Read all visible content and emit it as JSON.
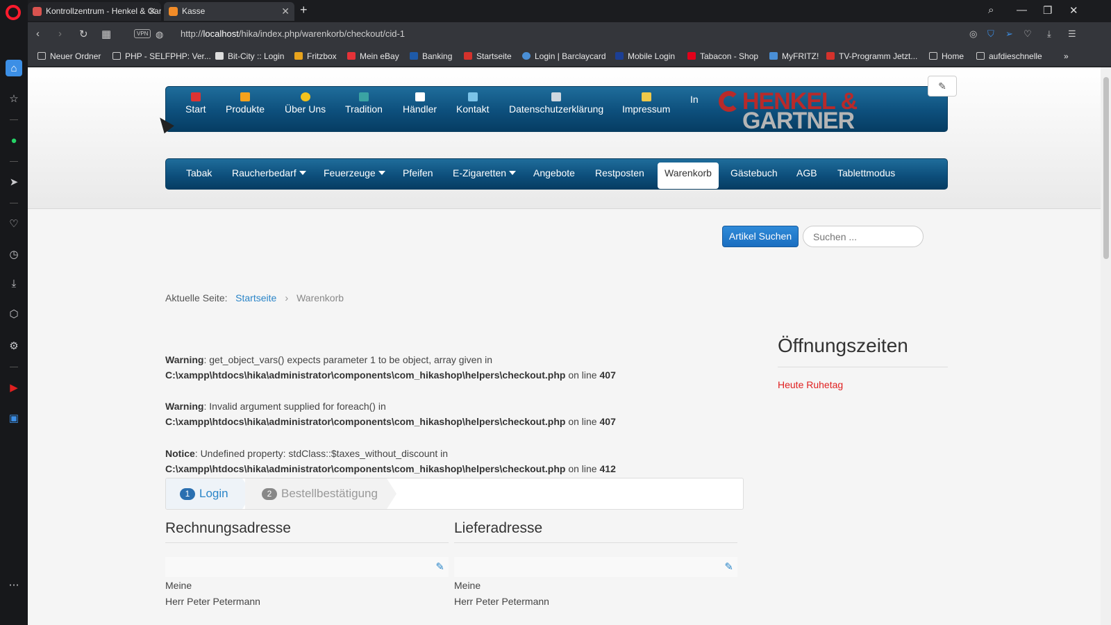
{
  "browser": {
    "tabs": [
      {
        "title": "Kontrollzentrum - Henkel & Gartner"
      },
      {
        "title": "Kasse"
      }
    ],
    "url_prefix": "http://",
    "url_host": "localhost",
    "url_path": "/hika/index.php/warenkorb/checkout/cid-1",
    "vpn_label": "VPN",
    "bookmarks": [
      "Neuer Ordner",
      "PHP - SELFPHP: Ver...",
      "Bit-City :: Login",
      "Fritzbox",
      "Mein eBay",
      "Banking",
      "Startseite",
      "Login | Barclaycard",
      "Mobile Login",
      "Tabacon - Shop",
      "MyFRITZ!",
      "TV-Programm Jetzt...",
      "Home",
      "aufdieschnelle"
    ]
  },
  "topnav": {
    "items": [
      "Start",
      "Produkte",
      "Über Uns",
      "Tradition",
      "Händler",
      "Kontakt",
      "Datenschutzerklärung",
      "Impressum",
      "In"
    ],
    "logo_line1": "HENKEL &",
    "logo_line2": "GARTNER"
  },
  "mainnav": {
    "items": [
      {
        "label": "Tabak",
        "dropdown": false
      },
      {
        "label": "Raucherbedarf",
        "dropdown": true
      },
      {
        "label": "Feuerzeuge",
        "dropdown": true
      },
      {
        "label": "Pfeifen",
        "dropdown": false
      },
      {
        "label": "E-Zigaretten",
        "dropdown": true
      },
      {
        "label": "Angebote",
        "dropdown": false
      },
      {
        "label": "Restposten",
        "dropdown": false
      },
      {
        "label": "Warenkorb",
        "dropdown": false,
        "active": true
      },
      {
        "label": "Gästebuch",
        "dropdown": false
      },
      {
        "label": "AGB",
        "dropdown": false
      },
      {
        "label": "Tablettmodus",
        "dropdown": false
      }
    ]
  },
  "search": {
    "button_label": "Artikel Suchen",
    "placeholder": "Suchen ..."
  },
  "breadcrumb": {
    "prefix": "Aktuelle Seite:",
    "home": "Startseite",
    "current": "Warenkorb"
  },
  "messages": [
    {
      "type": "Warning",
      "text": ": get_object_vars() expects parameter 1 to be object, array given in",
      "path": "C:\\xampp\\htdocs\\hika\\administrator\\components\\com_hikashop\\helpers\\checkout.php",
      "on_line": " on line ",
      "line": "407"
    },
    {
      "type": "Warning",
      "text": ": Invalid argument supplied for foreach() in",
      "path": "C:\\xampp\\htdocs\\hika\\administrator\\components\\com_hikashop\\helpers\\checkout.php",
      "on_line": " on line ",
      "line": "407"
    },
    {
      "type": "Notice",
      "text": ": Undefined property: stdClass::$taxes_without_discount in",
      "path": "C:\\xampp\\htdocs\\hika\\administrator\\components\\com_hikashop\\helpers\\checkout.php",
      "on_line": " on line ",
      "line": "412"
    }
  ],
  "steps": [
    {
      "num": "1",
      "label": "Login"
    },
    {
      "num": "2",
      "label": "Bestellbestätigung"
    }
  ],
  "billing": {
    "title": "Rechnungsadresse",
    "line1": "Meine",
    "line2": "Herr Peter Petermann"
  },
  "shipping": {
    "title": "Lieferadresse",
    "line1": "Meine",
    "line2": "Herr Peter Petermann"
  },
  "sidebar": {
    "title": "Öffnungszeiten",
    "status": "Heute Ruhetag"
  },
  "colors": {
    "nav_blue": "#0d4f7c",
    "link_blue": "#2a85c8",
    "alert_red": "#e02020",
    "brand_red": "#b82a2a"
  }
}
